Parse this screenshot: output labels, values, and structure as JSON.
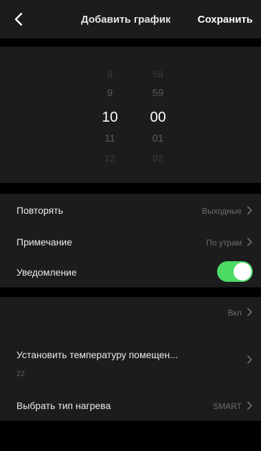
{
  "header": {
    "title": "Добавить график",
    "save_label": "Сохранить"
  },
  "time_picker": {
    "hours": [
      "8",
      "9",
      "10",
      "11",
      "12"
    ],
    "minutes": [
      "58",
      "59",
      "00",
      "01",
      "02"
    ],
    "selected_hour": "10",
    "selected_minute": "00"
  },
  "settings": {
    "repeat": {
      "label": "Повторять",
      "value": "Выходные"
    },
    "note": {
      "label": "Примечание",
      "value": "По утрам"
    },
    "notification": {
      "label": "Уведомление",
      "enabled": true
    }
  },
  "heating": {
    "power": {
      "value": "Вкл"
    },
    "room_temperature": {
      "label": "Установить температуру помещен...",
      "value": "22"
    },
    "heating_type": {
      "label": "Выбрать тип нагрева",
      "value": "SMART"
    }
  },
  "colors": {
    "accent_toggle": "#4cd964",
    "background": "#000000",
    "panel": "#1c1c1e"
  }
}
